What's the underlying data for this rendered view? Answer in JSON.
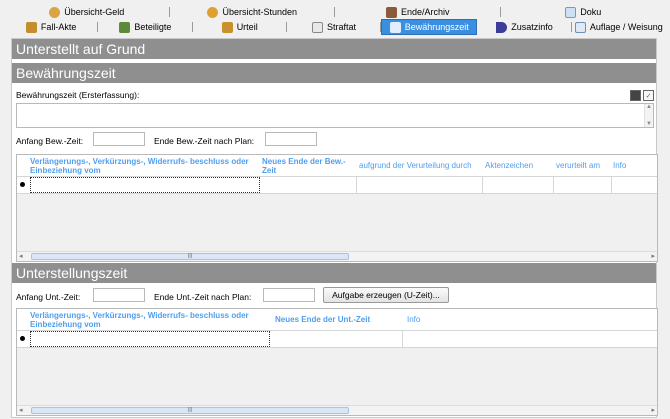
{
  "tabs": {
    "row1": [
      {
        "label": "Übersicht-Geld",
        "icon": "coins-icon",
        "color": "#d9a441"
      },
      {
        "label": "Übersicht-Stunden",
        "icon": "clock-icon",
        "color": "#e0a030"
      },
      {
        "label": "Ende/Archiv",
        "icon": "archive-person-icon",
        "color": "#8a5a3a"
      },
      {
        "label": "Doku",
        "icon": "document-icon",
        "color": "#6f9bd4"
      }
    ],
    "row2": [
      {
        "label": "Fall-Akte",
        "icon": "folder-icon",
        "color": "#c78c2b"
      },
      {
        "label": "Beteiligte",
        "icon": "people-icon",
        "color": "#5a8a3a"
      },
      {
        "label": "Urteil",
        "icon": "gavel-icon",
        "color": "#c9902e"
      },
      {
        "label": "Straftat",
        "icon": "document-list-icon",
        "color": "#8a8a8a"
      },
      {
        "label": "Bewährungszeit",
        "icon": "probation-icon",
        "color": "#ffffff",
        "active": true
      },
      {
        "label": "Zusatzinfo",
        "icon": "info-arrow-icon",
        "color": "#3c3c9a"
      },
      {
        "label": "Auflage / Weisung",
        "icon": "notes-icon",
        "color": "#6a90c0"
      }
    ]
  },
  "sections": {
    "unterstellt": "Unterstellt auf Grund",
    "bewaehrung": "Bewährungszeit",
    "unterstellung": "Unterstellungszeit"
  },
  "bewaehrung": {
    "ersterfassung_label": "Bewährungszeit (Ersterfassung):",
    "ersterfassung_value": "",
    "anfang_label": "Anfang Bew.-Zeit:",
    "anfang_value": "",
    "ende_label": "Ende Bew.-Zeit nach Plan:",
    "ende_value": ""
  },
  "grid1": {
    "columns": [
      "Verlängerungs-, Verkürzungs-, Widerrufs- beschluss oder Einbeziehung vom",
      "Neues Ende der Bew.-Zeit",
      "aufgrund der Verurteilung durch",
      "Aktenzeichen",
      "verurteilt am",
      "Info"
    ],
    "rows": []
  },
  "unterstellung": {
    "anfang_label": "Anfang Unt.-Zeit:",
    "anfang_value": "",
    "ende_label": "Ende Unt.-Zeit nach Plan:",
    "ende_value": "",
    "button_label": "Aufgabe erzeugen (U-Zeit)..."
  },
  "grid2": {
    "columns": [
      "Verlängerungs-, Verkürzungs-, Widerrufs- beschluss oder Einbeziehung vom",
      "Neues Ende der Unt.-Zeit",
      "Info"
    ],
    "rows": []
  },
  "colors": {
    "section_bar": "#8f8f8f",
    "active_tab": "#3b8fe0",
    "column_header": "#4f9ef0"
  }
}
